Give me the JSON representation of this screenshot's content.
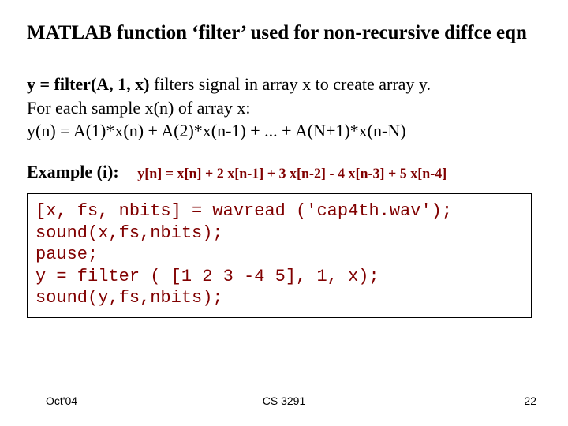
{
  "title": "MATLAB function ‘filter’ used for non-recursive diffce eqn",
  "body": {
    "sig": "y = filter(A, 1, x)",
    "sig_tail": "  filters signal in array x to create array y.",
    "line2": "For each sample x(n) of array x:",
    "line3": "y(n) =  A(1)*x(n) + A(2)*x(n-1) + ... + A(N+1)*x(n-N)"
  },
  "example": {
    "label": "Example (i):",
    "equation": "y[n]  =  x[n] + 2 x[n-1] + 3 x[n-2] - 4 x[n-3] + 5 x[n-4]"
  },
  "code": "[x, fs, nbits] = wavread ('cap4th.wav');\nsound(x,fs,nbits);\npause;\ny = filter ( [1 2 3 -4 5], 1, x);\nsound(y,fs,nbits);",
  "footer": {
    "left": "Oct'04",
    "center": "CS 3291",
    "right": "22"
  }
}
